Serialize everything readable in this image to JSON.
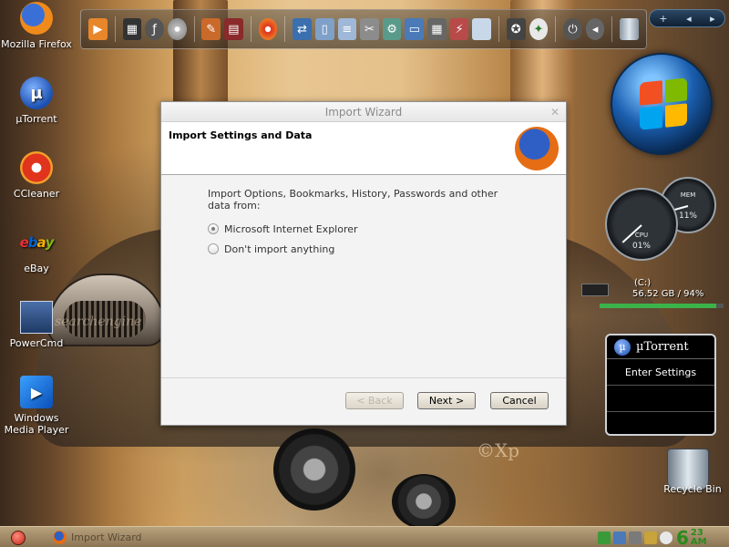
{
  "desktop": {
    "icons": [
      {
        "label": "Mozilla Firefox"
      },
      {
        "label": "µTorrent"
      },
      {
        "label": "CCleaner"
      },
      {
        "label": "eBay"
      },
      {
        "label": "PowerCmd"
      },
      {
        "label": "Windows Media Player"
      }
    ],
    "ebay_letters": [
      "e",
      "b",
      "a",
      "y"
    ],
    "utorrent_glyph": "µ",
    "recycle_bin_label": "Recycle Bin",
    "watermark": "©Xp",
    "wallpaper_signature": "searchengine"
  },
  "pager": {
    "plus": "+",
    "prev": "◂",
    "next": "▸"
  },
  "system_gadget": {
    "cpu_label": "CPU",
    "cpu_value": "01%",
    "cpu_fraction": 0.01,
    "mem_label": "MEM",
    "mem_value": "11%",
    "mem_fraction": 0.11
  },
  "drive_gadget": {
    "drive": "(C:)",
    "info": "56.52 GB / 94%",
    "used_fraction": 0.94
  },
  "utorrent_gadget": {
    "title": "µTorrent",
    "logo_glyph": "µ",
    "settings_label": "Enter Settings"
  },
  "dialog": {
    "title": "Import Wizard",
    "close_glyph": "✕",
    "heading": "Import Settings and Data",
    "prompt": "Import Options, Bookmarks, History, Passwords and other data from:",
    "options": [
      {
        "label": "Microsoft Internet Explorer",
        "selected": true
      },
      {
        "label": "Don't import anything",
        "selected": false
      }
    ],
    "buttons": {
      "back": "< Back",
      "next": "Next >",
      "cancel": "Cancel"
    }
  },
  "taskbar": {
    "task_label": "Import Wizard",
    "clock_hour": "6",
    "clock_minute": "23",
    "clock_ampm": "AM"
  },
  "colors": {
    "clock": "#2a8a1e",
    "dialog_bg": "#f3f3f3",
    "taskbar": "#a08a66"
  }
}
